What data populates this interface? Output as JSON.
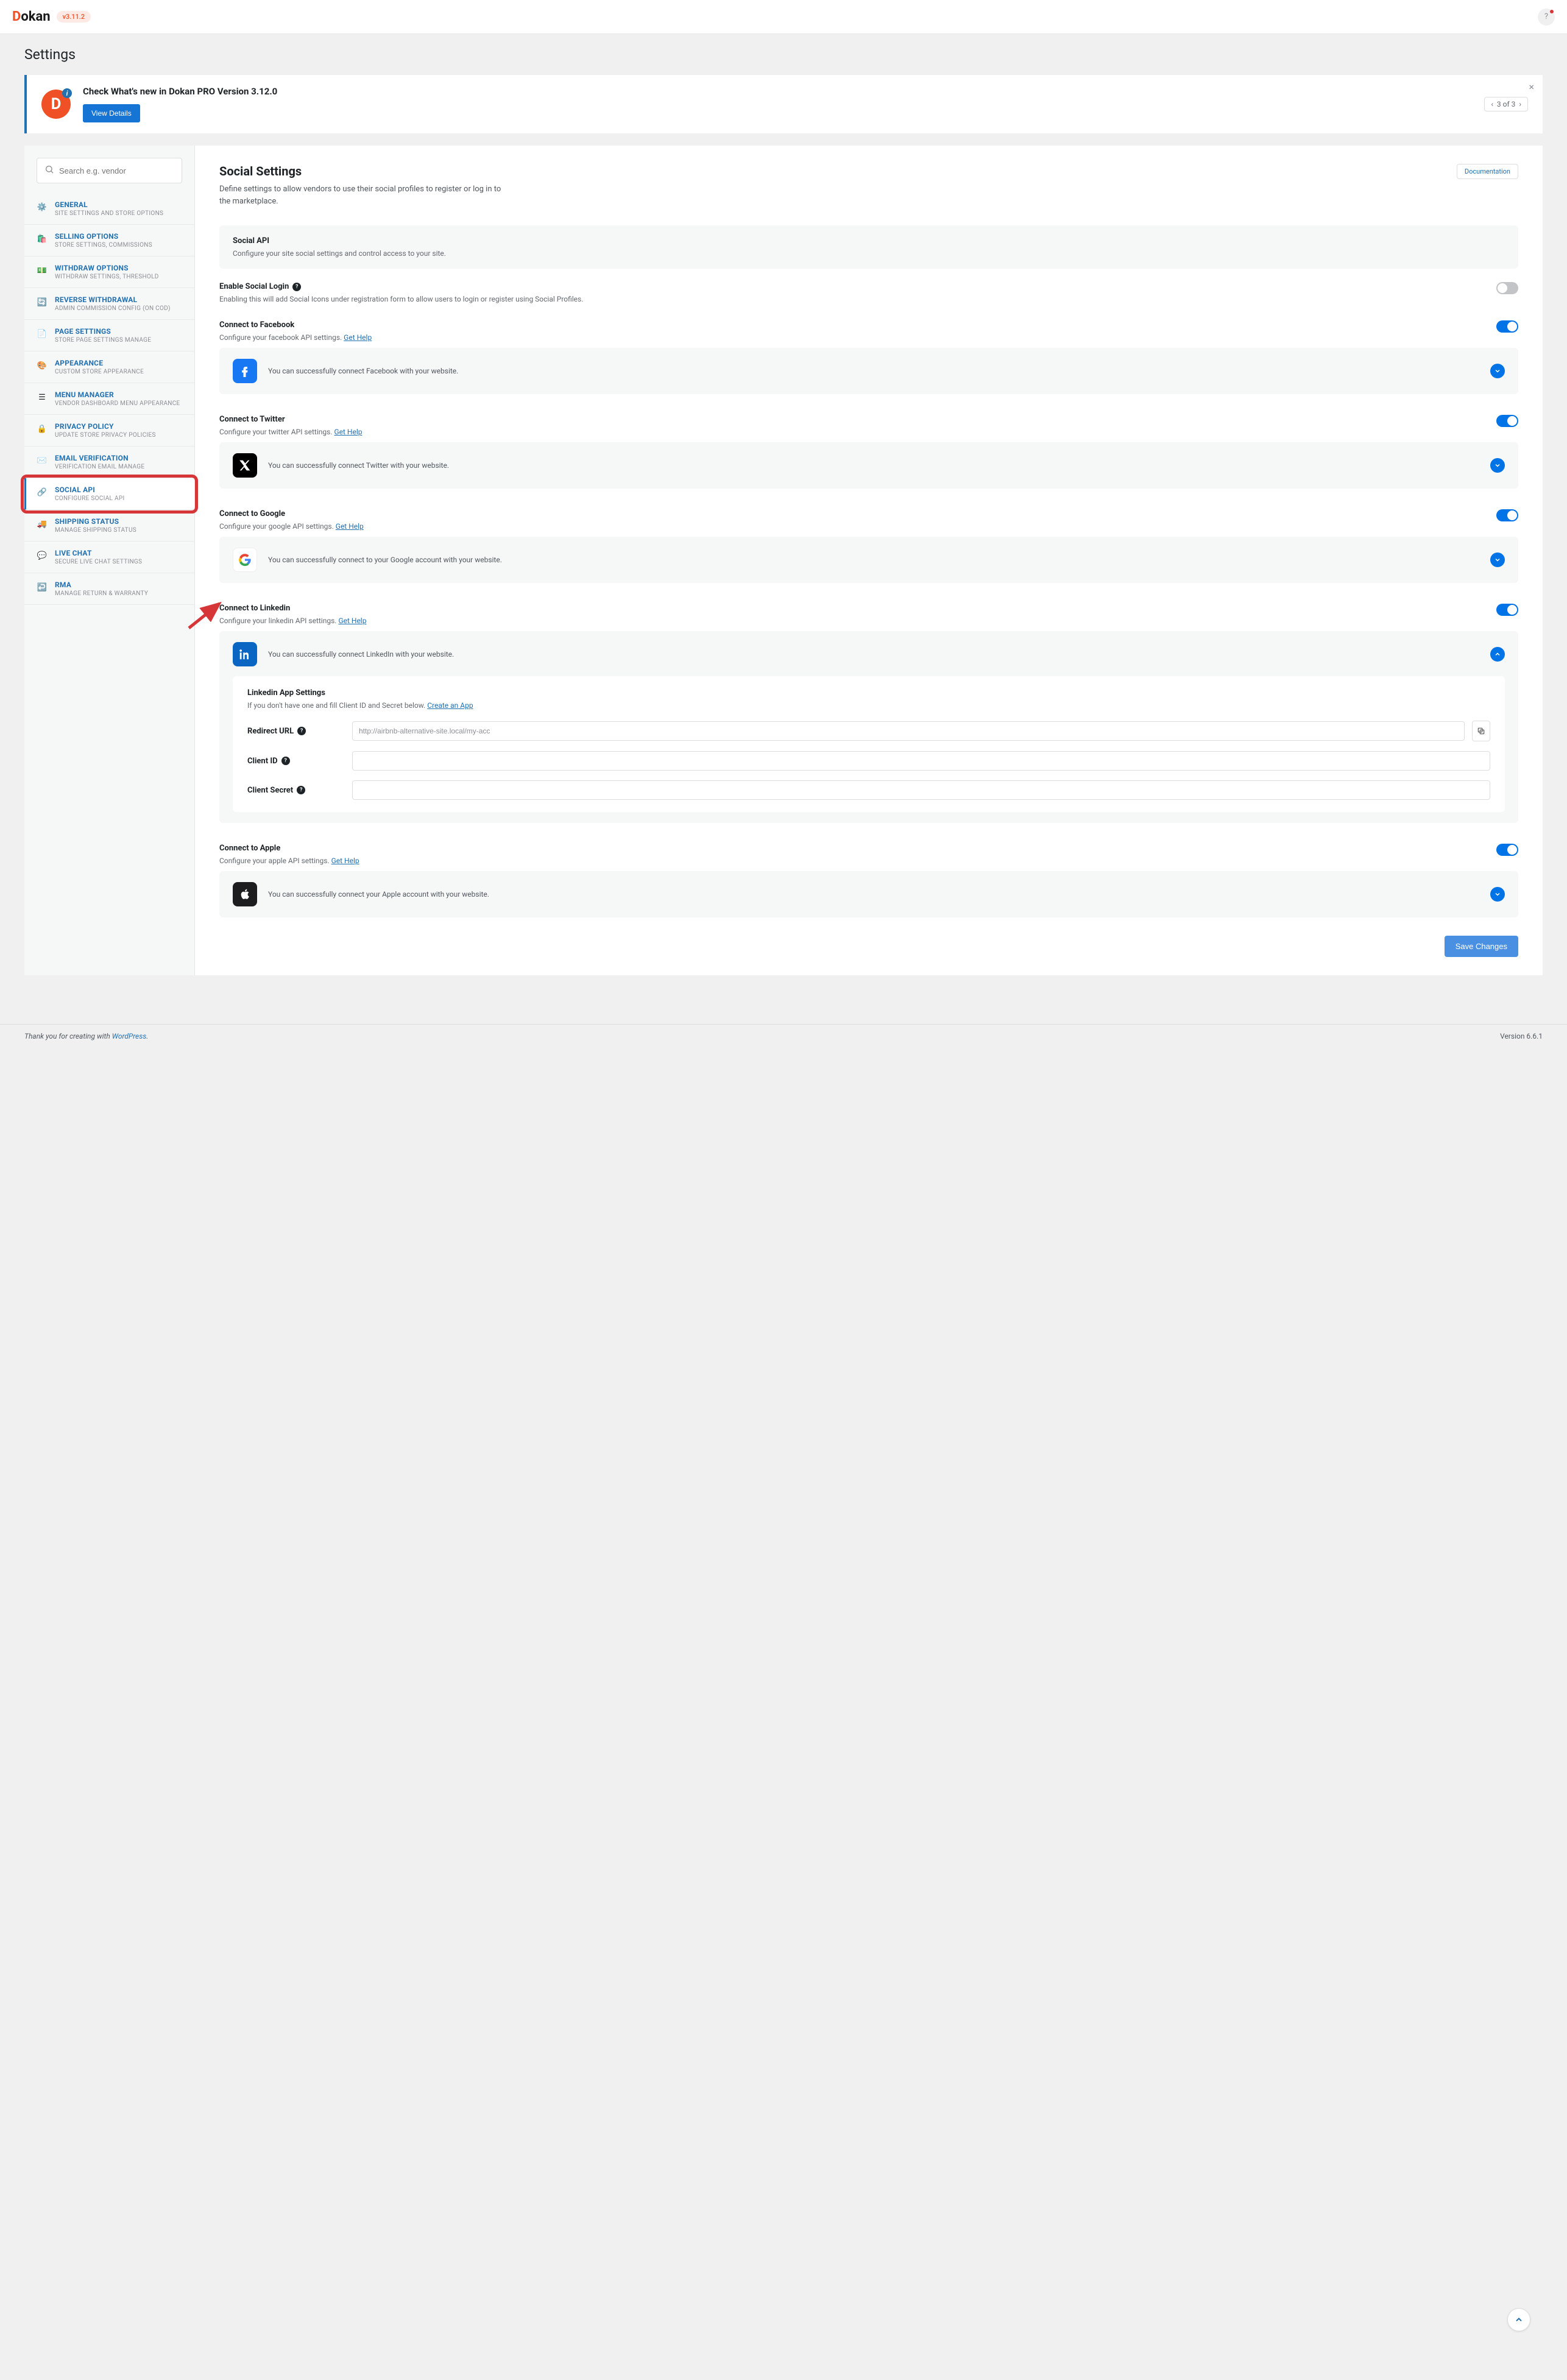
{
  "brand": {
    "name_part1": "D",
    "name_part2": "okan",
    "version": "v3.11.2"
  },
  "page_title": "Settings",
  "notice": {
    "title": "Check What's new in Dokan PRO Version 3.12.0",
    "button": "View Details",
    "pager": "3 of 3"
  },
  "search_placeholder": "Search e.g. vendor",
  "nav": [
    {
      "label": "GENERAL",
      "desc": "SITE SETTINGS AND STORE OPTIONS",
      "icon": "⚙️"
    },
    {
      "label": "SELLING OPTIONS",
      "desc": "STORE SETTINGS, COMMISSIONS",
      "icon": "🛍️"
    },
    {
      "label": "WITHDRAW OPTIONS",
      "desc": "WITHDRAW SETTINGS, THRESHOLD",
      "icon": "💵"
    },
    {
      "label": "REVERSE WITHDRAWAL",
      "desc": "ADMIN COMMISSION CONFIG (ON COD)",
      "icon": "🔄"
    },
    {
      "label": "PAGE SETTINGS",
      "desc": "STORE PAGE SETTINGS MANAGE",
      "icon": "📄"
    },
    {
      "label": "APPEARANCE",
      "desc": "CUSTOM STORE APPEARANCE",
      "icon": "🎨"
    },
    {
      "label": "MENU MANAGER",
      "desc": "VENDOR DASHBOARD MENU APPEARANCE",
      "icon": "☰"
    },
    {
      "label": "PRIVACY POLICY",
      "desc": "UPDATE STORE PRIVACY POLICIES",
      "icon": "🔒"
    },
    {
      "label": "EMAIL VERIFICATION",
      "desc": "VERIFICATION EMAIL MANAGE",
      "icon": "✉️"
    },
    {
      "label": "SOCIAL API",
      "desc": "CONFIGURE SOCIAL API",
      "icon": "🔗"
    },
    {
      "label": "SHIPPING STATUS",
      "desc": "MANAGE SHIPPING STATUS",
      "icon": "🚚"
    },
    {
      "label": "LIVE CHAT",
      "desc": "SECURE LIVE CHAT SETTINGS",
      "icon": "💬"
    },
    {
      "label": "RMA",
      "desc": "MANAGE RETURN & WARRANTY",
      "icon": "↩️"
    }
  ],
  "content": {
    "title": "Social Settings",
    "subtitle": "Define settings to allow vendors to use their social profiles to register or log in to the marketplace.",
    "doc_link": "Documentation"
  },
  "api_section": {
    "title": "Social API",
    "desc": "Configure your site social settings and control access to your site."
  },
  "enable_login": {
    "label": "Enable Social Login",
    "desc": "Enabling this will add Social Icons under registration form to allow users to login or register using Social Profiles."
  },
  "connects": {
    "facebook": {
      "title": "Connect to Facebook",
      "desc": "Configure your facebook API settings.",
      "help": "Get Help",
      "card": "You can successfully connect Facebook with your website."
    },
    "twitter": {
      "title": "Connect to Twitter",
      "desc": "Configure your twitter API settings.",
      "help": "Get Help",
      "card": "You can successfully connect Twitter with your website."
    },
    "google": {
      "title": "Connect to Google",
      "desc": "Configure your google API settings.",
      "help": "Get Help",
      "card": "You can successfully connect to your Google account with your website."
    },
    "linkedin": {
      "title": "Connect to Linkedin",
      "desc": "Configure your linkedin API settings.",
      "help": "Get Help",
      "card": "You can successfully connect LinkedIn with your website.",
      "app_title": "Linkedin App Settings",
      "app_desc": "If you don't have one and fill Client ID and Secret below.",
      "create_link": "Create an App",
      "redirect_label": "Redirect URL",
      "redirect_value": "http://airbnb-alternative-site.local/my-acc",
      "client_id_label": "Client ID",
      "client_secret_label": "Client Secret"
    },
    "apple": {
      "title": "Connect to Apple",
      "desc": "Configure your apple API settings.",
      "help": "Get Help",
      "card": "You can successfully connect your Apple account with your website."
    }
  },
  "save_button": "Save Changes",
  "footer": {
    "thanks": "Thank you for creating with ",
    "wp": "WordPress",
    "version": "Version 6.6.1"
  }
}
